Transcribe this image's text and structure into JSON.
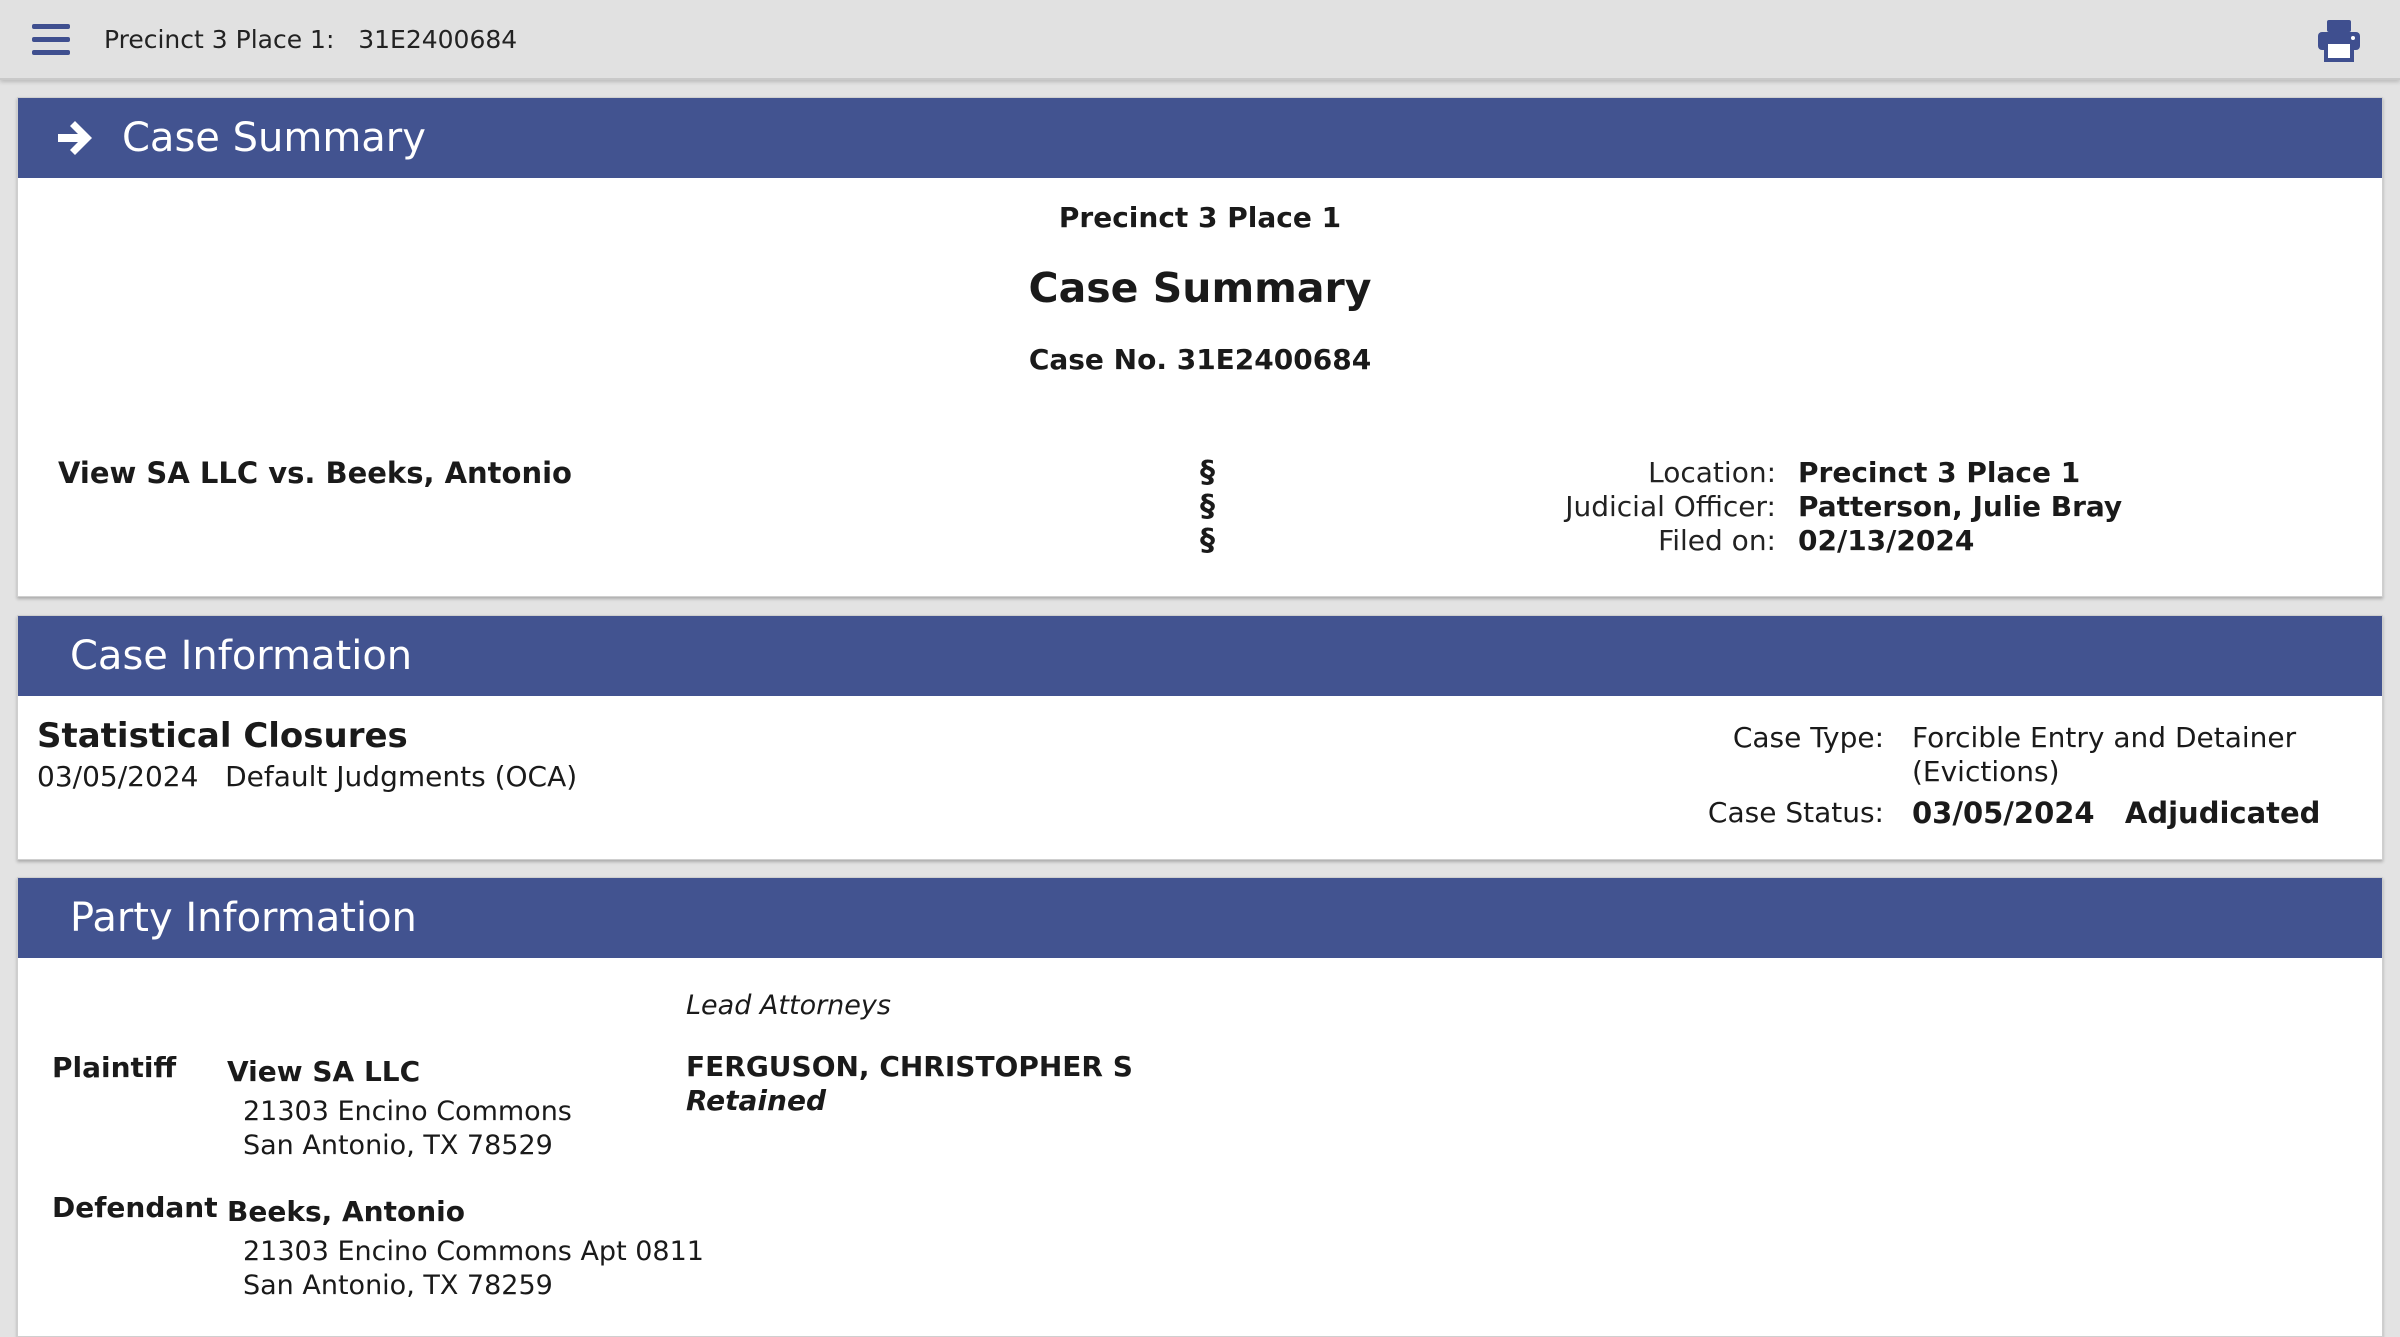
{
  "topbar": {
    "title": "Precinct 3 Place 1:   31E2400684",
    "menu_icon": "hamburger-menu-icon",
    "print_icon": "printer-icon"
  },
  "case_summary": {
    "header": "Case Summary",
    "court": "Precinct 3 Place 1",
    "title": "Case Summary",
    "case_no": "Case No. 31E2400684",
    "style": "View SA LLC vs. Beeks, Antonio",
    "section_marks": [
      "§",
      "§",
      "§"
    ],
    "details": [
      {
        "label": "Location:",
        "value": "Precinct 3 Place 1"
      },
      {
        "label": "Judicial Officer:",
        "value": "Patterson, Julie Bray"
      },
      {
        "label": "Filed on:",
        "value": "02/13/2024"
      }
    ]
  },
  "case_information": {
    "header": "Case Information",
    "stat_title": "Statistical Closures",
    "stat_date": "03/05/2024",
    "stat_desc": "Default Judgments (OCA)",
    "case_type_label": "Case Type:",
    "case_type_value": "Forcible Entry and Detainer (Evictions)",
    "case_status_label": "Case Status:",
    "case_status_date": "03/05/2024",
    "case_status_value": "Adjudicated"
  },
  "party_information": {
    "header": "Party Information",
    "lead_attorneys_header": "Lead Attorneys",
    "parties": [
      {
        "role": "Plaintiff",
        "name": "View SA LLC",
        "address_line1": "21303 Encino Commons",
        "address_line2": "San Antonio, TX 78529",
        "attorney": "FERGUSON, CHRISTOPHER S",
        "attorney_status": "Retained"
      },
      {
        "role": "Defendant",
        "name": "Beeks, Antonio",
        "address_line1": "21303 Encino Commons Apt 0811",
        "address_line2": "San Antonio, TX 78259"
      }
    ]
  },
  "colors": {
    "header_blue": "#425390",
    "topbar_gray": "#e1e1e1",
    "icon_blue": "#3f4f8f"
  }
}
